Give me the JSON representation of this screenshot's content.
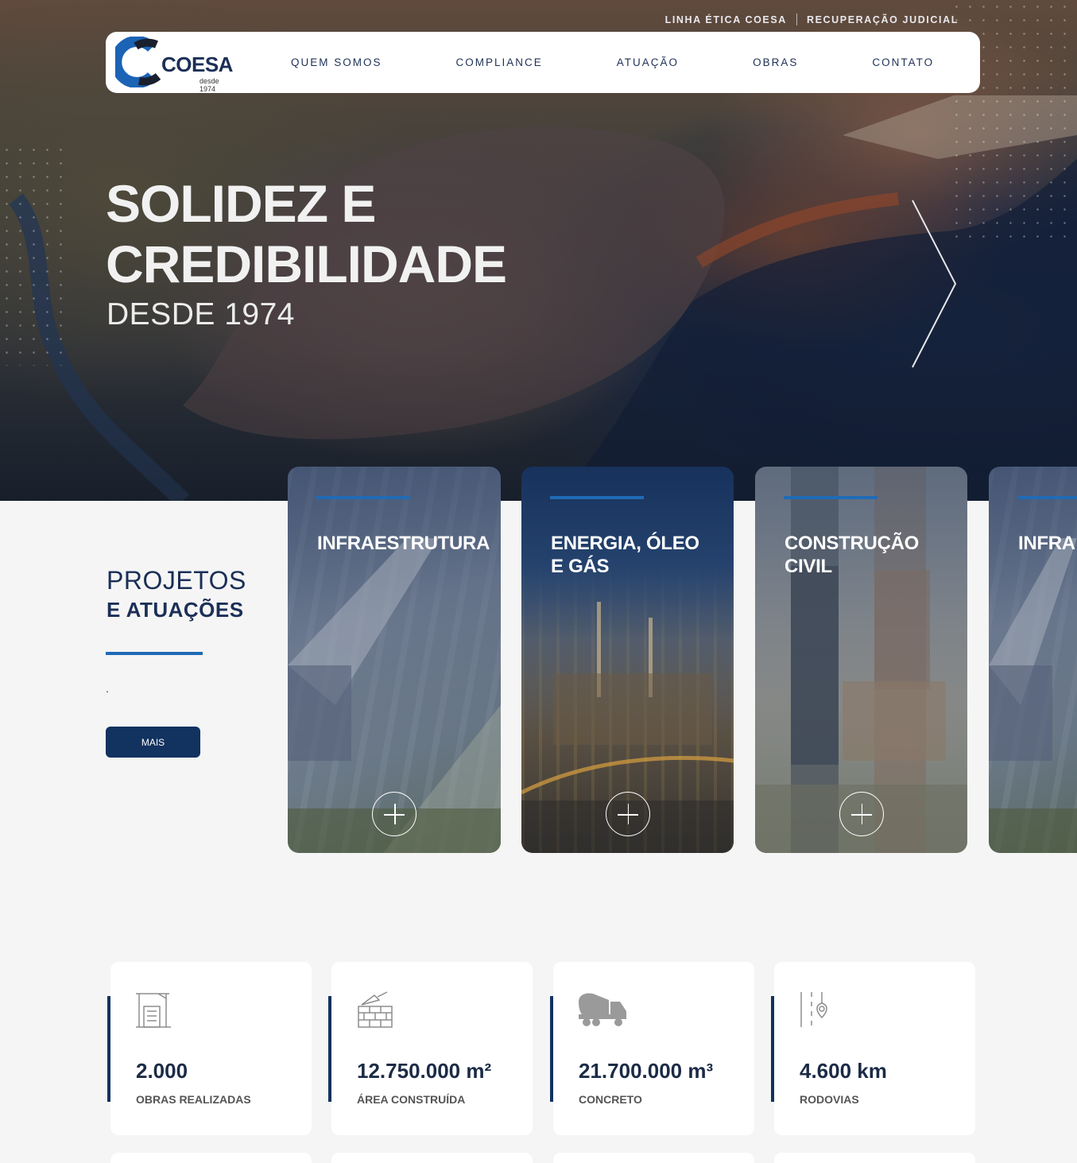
{
  "topbar": {
    "links": [
      "LINHA ÉTICA COESA",
      "RECUPERAÇÃO JUDICIAL"
    ]
  },
  "brand": {
    "name": "COESA",
    "since": "desde 1974"
  },
  "nav": {
    "items": [
      "QUEM SOMOS",
      "COMPLIANCE",
      "ATUAÇÃO",
      "OBRAS",
      "CONTATO"
    ]
  },
  "hero": {
    "title_line1": "SOLIDEZ E",
    "title_line2": "CREDIBILIDADE",
    "subtitle": "DESDE 1974"
  },
  "projects": {
    "heading_light": "PROJETOS",
    "heading_bold": "E ATUAÇÕES",
    "text": ".",
    "button": "MAIS",
    "cards": [
      {
        "title_line1": "INFRAESTRUTURA",
        "title_line2": ""
      },
      {
        "title_line1": "ENERGIA, ÓLEO",
        "title_line2": "E GÁS"
      },
      {
        "title_line1": "CONSTRUÇÃO",
        "title_line2": "CIVIL"
      },
      {
        "title_line1": "INFRA",
        "title_line2": ""
      }
    ]
  },
  "stats": [
    {
      "icon": "crane-building-icon",
      "value": "2.000",
      "label": "OBRAS REALIZADAS"
    },
    {
      "icon": "trowel-bricks-icon",
      "value": "12.750.000 m²",
      "label": "ÁREA CONSTRUÍDA"
    },
    {
      "icon": "concrete-mixer-icon",
      "value": "21.700.000 m³",
      "label": "CONCRETO"
    },
    {
      "icon": "road-pin-icon",
      "value": "4.600 km",
      "label": "RODOVIAS"
    }
  ],
  "colors": {
    "navy": "#12325f",
    "accent_blue": "#1f6bb6",
    "logo_blue": "#1b63b5",
    "text_dark": "#1b2b46"
  }
}
